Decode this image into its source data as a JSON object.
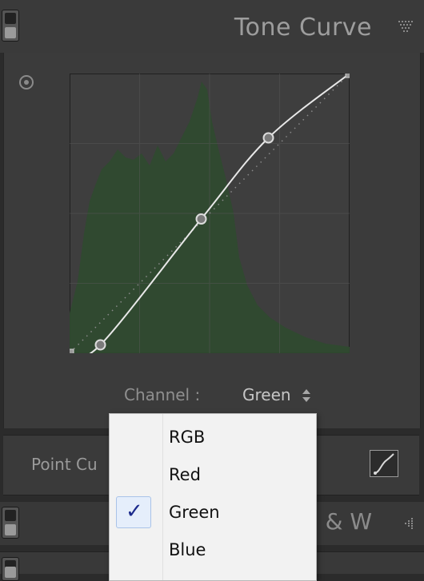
{
  "panel": {
    "title": "Tone Curve",
    "channel_label": "Channel :",
    "channel_value": "Green",
    "point_curve_label": "Point Cu"
  },
  "next_panel": {
    "title": "B & W"
  },
  "channel_menu": {
    "items": [
      "RGB",
      "Red",
      "Green",
      "Blue"
    ],
    "selected": "Green",
    "check_glyph": "✓"
  },
  "curve": {
    "points": [
      [
        0,
        0
      ],
      [
        0.11,
        0.03
      ],
      [
        0.47,
        0.48
      ],
      [
        0.71,
        0.77
      ],
      [
        1,
        1
      ]
    ]
  },
  "colors": {
    "curve": "#e8e8e8",
    "histogram": "#2e4a2e",
    "menu_bg": "#f2f2f2",
    "check": "#1c2a8c"
  }
}
